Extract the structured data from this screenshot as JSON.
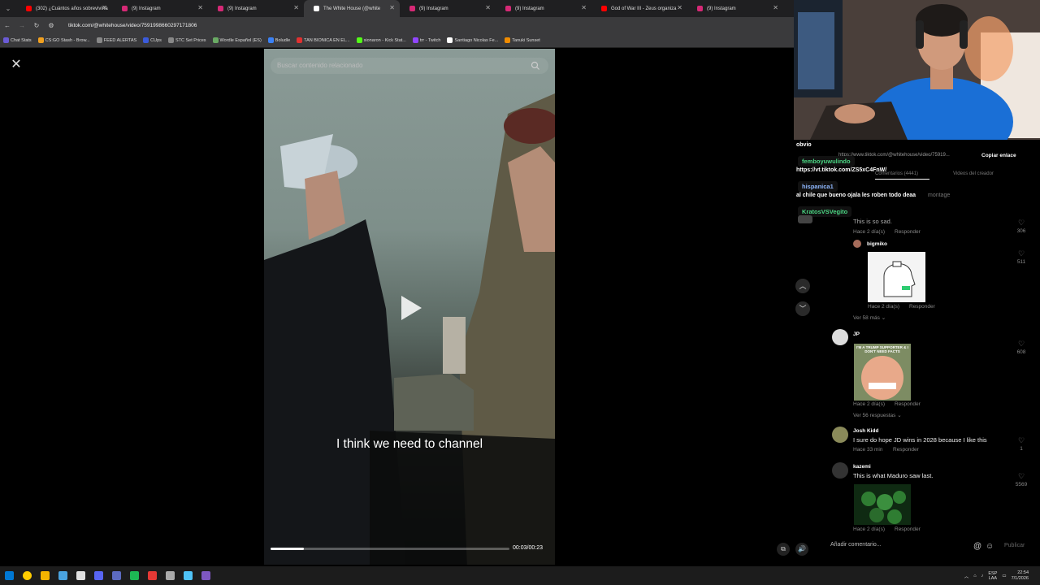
{
  "browser": {
    "tabs": [
      {
        "label": "(302) ¿Cuántos años sobreviviría",
        "color": "#ff0000"
      },
      {
        "label": "(9) Instagram",
        "color": "#d62976"
      },
      {
        "label": "(9) Instagram",
        "color": "#d62976"
      },
      {
        "label": "The White House (@white",
        "color": "#ffffff",
        "active": true
      },
      {
        "label": "(9) Instagram",
        "color": "#d62976"
      },
      {
        "label": "(9) Instagram",
        "color": "#d62976"
      },
      {
        "label": "God of War III - Zeus organiza",
        "color": "#ff0000"
      },
      {
        "label": "(9) Instagram",
        "color": "#d62976"
      }
    ],
    "url": "tiktok.com/@whitehouse/video/7591998660297171806",
    "bookmarks": [
      {
        "label": "Chat Stats",
        "color": "#6b5bd6"
      },
      {
        "label": "CS:GO Stash - Brow...",
        "color": "#f0a020"
      },
      {
        "label": "FEED ALERTAS",
        "color": "#888888"
      },
      {
        "label": "CUps",
        "color": "#3b5bdb"
      },
      {
        "label": "STC Set Prices",
        "color": "#888888"
      },
      {
        "label": "Wordle Español (ES)",
        "color": "#6aaa64"
      },
      {
        "label": "Boludle",
        "color": "#3b82f6"
      },
      {
        "label": "TAN BIONICA EN EL...",
        "color": "#e03131"
      },
      {
        "label": "sionaron - Kick Stat...",
        "color": "#53fc18"
      },
      {
        "label": "trr - Twitch",
        "color": "#9146ff"
      },
      {
        "label": "Santiago Nicolas Fe...",
        "color": "#ffffff"
      },
      {
        "label": "Tanuki Sunset",
        "color": "#f08c00"
      }
    ]
  },
  "video": {
    "search_placeholder": "Buscar contenido relacionado",
    "subtitle": "I think we need to channel",
    "time": "00:03/00:23",
    "progress": 0.14
  },
  "chat": {
    "lines": [
      {
        "text": "obvio",
        "color": "#ffffff"
      },
      {
        "text": "https://vt.tiktok.com/ZS5xC4FnW/",
        "color": "#ffffff"
      },
      {
        "text": "al chile que bueno ojala les roben todo deaa",
        "color": "#ffffff"
      }
    ],
    "usernames": [
      "femboyuwulindo",
      "hispanica1",
      "KratosVSVegito"
    ],
    "copy_url": "https://www.tiktok.com/@whitehouse/video/75919...",
    "copy_button": "Copiar enlace",
    "tab_comments": "Comentarios (4441)",
    "tab_creator": "Videos del creador",
    "montage": "montage"
  },
  "comments": {
    "reply_label": "Responder",
    "items": [
      {
        "name": "",
        "text": "This is so sad.",
        "time": "Hace 2 día(s)",
        "likes": "306"
      },
      {
        "name": "bigmiko",
        "text": "",
        "time": "Hace 2 día(s)",
        "likes": "511",
        "more": "Ver 58 más"
      },
      {
        "name": "JP",
        "text": "",
        "time": "Hace 2 día(s)",
        "likes": "608",
        "more": "Ver 56 respuestas",
        "image_text": "I'M A TRUMP SUPPORTER & I DON'T NEED FACTS"
      },
      {
        "name": "Josh Kidd",
        "text": "I sure do hope JD wins in 2028 because I like this",
        "time": "Hace 33 min",
        "likes": "1"
      },
      {
        "name": "kazemi",
        "text": "This is what Maduro saw last.",
        "time": "Hace 2 día(s)",
        "likes": "5569"
      }
    ]
  },
  "comment_bar": {
    "placeholder": "Añadir comentario...",
    "publish": "Publicar"
  },
  "taskbar": {
    "lang": "ESP",
    "region": "LAA",
    "time": "22:54",
    "date": "7/1/2026",
    "icon_colors": [
      "#0078d4",
      "#ffcc00",
      "#f4b400",
      "#4aa3df",
      "#e0e0e0",
      "#5865f2",
      "#5c6bc0",
      "#1db954",
      "#e53935",
      "#aaaaaa",
      "#4fc3f7",
      "#7e57c2"
    ]
  }
}
